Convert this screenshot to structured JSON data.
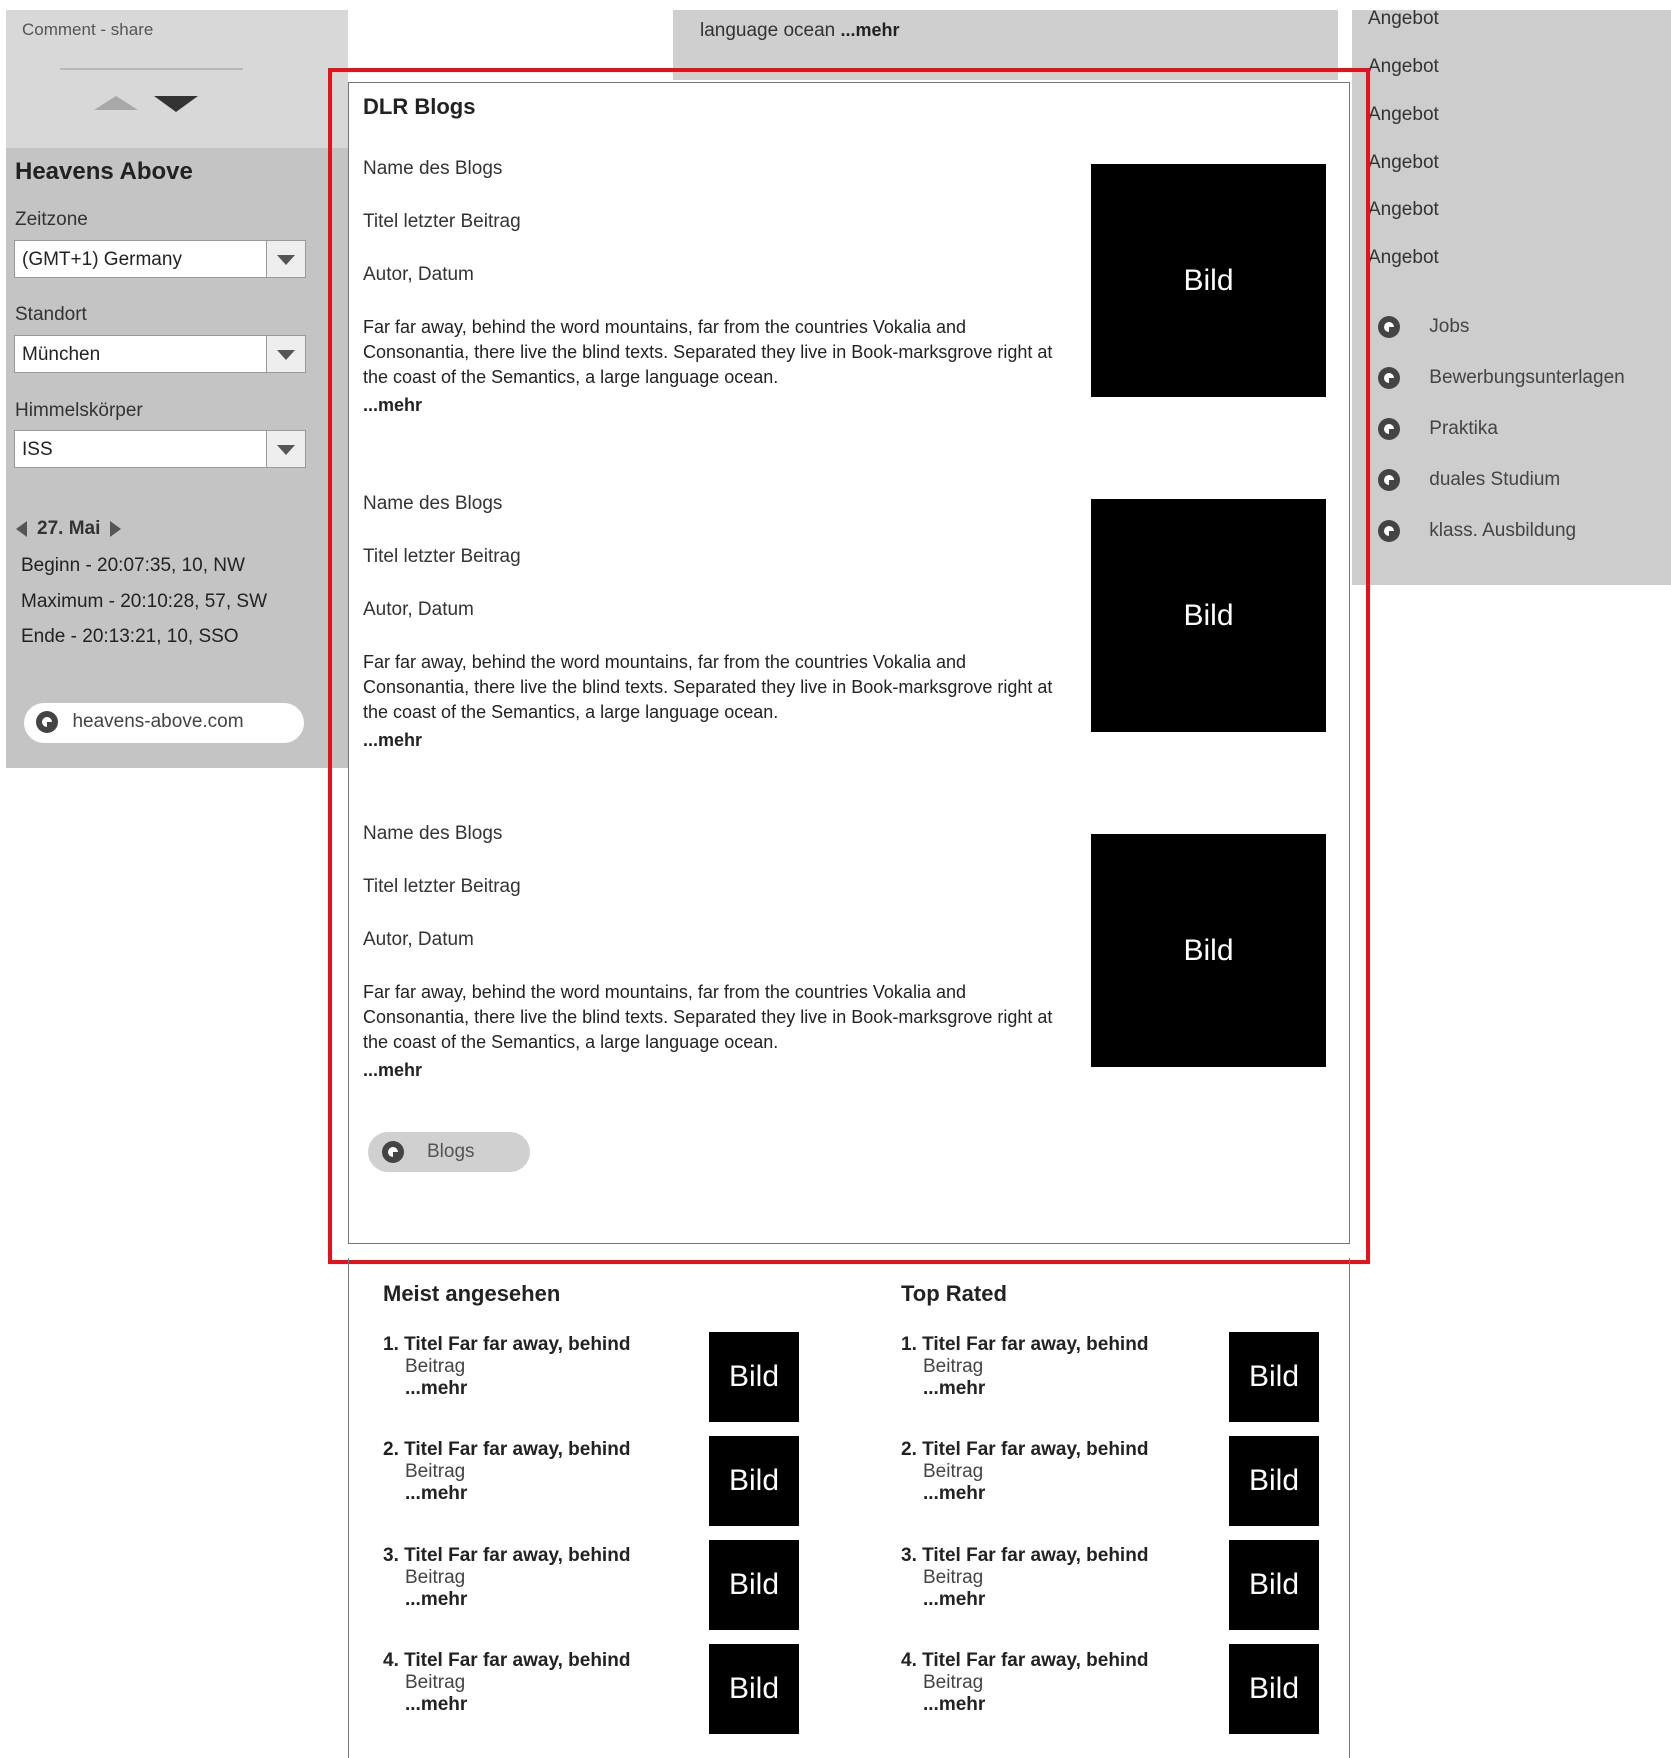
{
  "left": {
    "comment_share": "Comment - share",
    "heavens_title": "Heavens Above",
    "zeitzone_label": "Zeitzone",
    "zeitzone_value": "(GMT+1) Germany",
    "standort_label": "Standort",
    "standort_value": "München",
    "himmel_label": "Himmelskörper",
    "himmel_value": "ISS",
    "date": "27. Mai",
    "beginn": "Beginn  -  20:07:35, 10, NW",
    "maximum": "Maximum  -  20:10:28, 57, SW",
    "ende": "Ende  -  20:13:21, 10, SSO",
    "link": "heavens-above.com"
  },
  "top_strip": {
    "text": "language ocean",
    "mehr": "...mehr"
  },
  "right": {
    "angebote": [
      "Angebot",
      "Angebot",
      "Angebot",
      "Angebot",
      "Angebot",
      "Angebot"
    ],
    "links": [
      "Jobs",
      "Bewerbungsunterlagen",
      "Praktika",
      "duales Studium",
      "klass. Ausbildung"
    ]
  },
  "blogs": {
    "title": "DLR Blogs",
    "items": [
      {
        "name": "Name des Blogs",
        "title": "Titel letzter Beitrag",
        "author": "Autor, Datum",
        "text": "Far far away, behind the word mountains, far from the countries Vokalia and Consonantia, there live the blind texts. Separated they live in Book-marksgrove right at the coast of the Semantics, a large language ocean.",
        "mehr": "...mehr",
        "image": "Bild"
      },
      {
        "name": "Name des Blogs",
        "title": "Titel letzter Beitrag",
        "author": "Autor, Datum",
        "text": "Far far away, behind the word mountains, far from the countries Vokalia and Consonantia, there live the blind texts. Separated they live in Book-marksgrove right at the coast of the Semantics, a large language ocean.",
        "mehr": "...mehr",
        "image": "Bild"
      },
      {
        "name": "Name des Blogs",
        "title": "Titel letzter Beitrag",
        "author": "Autor, Datum",
        "text": "Far far away, behind the word mountains, far from the countries Vokalia and Consonantia, there live the blind texts. Separated they live in Book-marksgrove right at the coast of the Semantics, a large language ocean.",
        "mehr": "...mehr",
        "image": "Bild"
      }
    ],
    "button": "Blogs"
  },
  "meist": {
    "title": "Meist angesehen",
    "items": [
      {
        "title": "1. Titel Far far away, behind",
        "sub": "Beitrag",
        "mehr": "...mehr",
        "image": "Bild"
      },
      {
        "title": "2. Titel Far far away, behind",
        "sub": "Beitrag",
        "mehr": "...mehr",
        "image": "Bild"
      },
      {
        "title": "3. Titel Far far away, behind",
        "sub": "Beitrag",
        "mehr": "...mehr",
        "image": "Bild"
      },
      {
        "title": "4. Titel Far far away, behind",
        "sub": "Beitrag",
        "mehr": "...mehr",
        "image": "Bild"
      }
    ]
  },
  "top_rated": {
    "title": "Top Rated",
    "items": [
      {
        "title": "1. Titel Far far away, behind",
        "sub": "Beitrag",
        "mehr": "...mehr",
        "image": "Bild"
      },
      {
        "title": "2. Titel Far far away, behind",
        "sub": "Beitrag",
        "mehr": "...mehr",
        "image": "Bild"
      },
      {
        "title": "3. Titel Far far away, behind",
        "sub": "Beitrag",
        "mehr": "...mehr",
        "image": "Bild"
      },
      {
        "title": "4. Titel Far far away, behind",
        "sub": "Beitrag",
        "mehr": "...mehr",
        "image": "Bild"
      }
    ]
  },
  "colors": {
    "highlight": "#e8101a",
    "panel_gray": "#c4c4c4",
    "image_black": "#000000"
  }
}
